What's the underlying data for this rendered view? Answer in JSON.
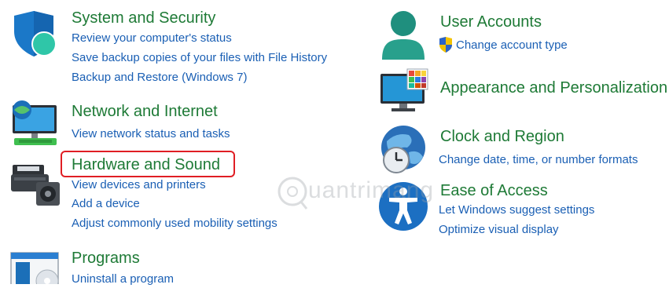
{
  "categories": {
    "system_security": {
      "title": "System and Security",
      "links": [
        "Review your computer's status",
        "Save backup copies of your files with File History",
        "Backup and Restore (Windows 7)"
      ]
    },
    "network": {
      "title": "Network and Internet",
      "links": [
        "View network status and tasks"
      ]
    },
    "hardware": {
      "title": "Hardware and Sound",
      "links": [
        "View devices and printers",
        "Add a device",
        "Adjust commonly used mobility settings"
      ]
    },
    "programs": {
      "title": "Programs",
      "links": [
        "Uninstall a program"
      ]
    },
    "user_accounts": {
      "title": "User Accounts",
      "links": [
        "Change account type"
      ]
    },
    "appearance": {
      "title": "Appearance and Personalization",
      "links": []
    },
    "clock": {
      "title": "Clock and Region",
      "links": [
        "Change date, time, or number formats"
      ]
    },
    "ease": {
      "title": "Ease of Access",
      "links": [
        "Let Windows suggest settings",
        "Optimize visual display"
      ]
    }
  },
  "watermark": "uantrimang",
  "colors": {
    "title": "#1e7a36",
    "link": "#1a5fb4",
    "highlight": "#e01e24"
  },
  "icons": {
    "system_security": "shield-icon",
    "network": "network-monitor-icon",
    "hardware": "printer-speaker-icon",
    "programs": "programs-disc-icon",
    "user_accounts": "user-icon",
    "uac": "uac-shield-icon",
    "appearance": "monitor-colors-icon",
    "clock": "globe-clock-icon",
    "ease": "accessibility-icon"
  }
}
